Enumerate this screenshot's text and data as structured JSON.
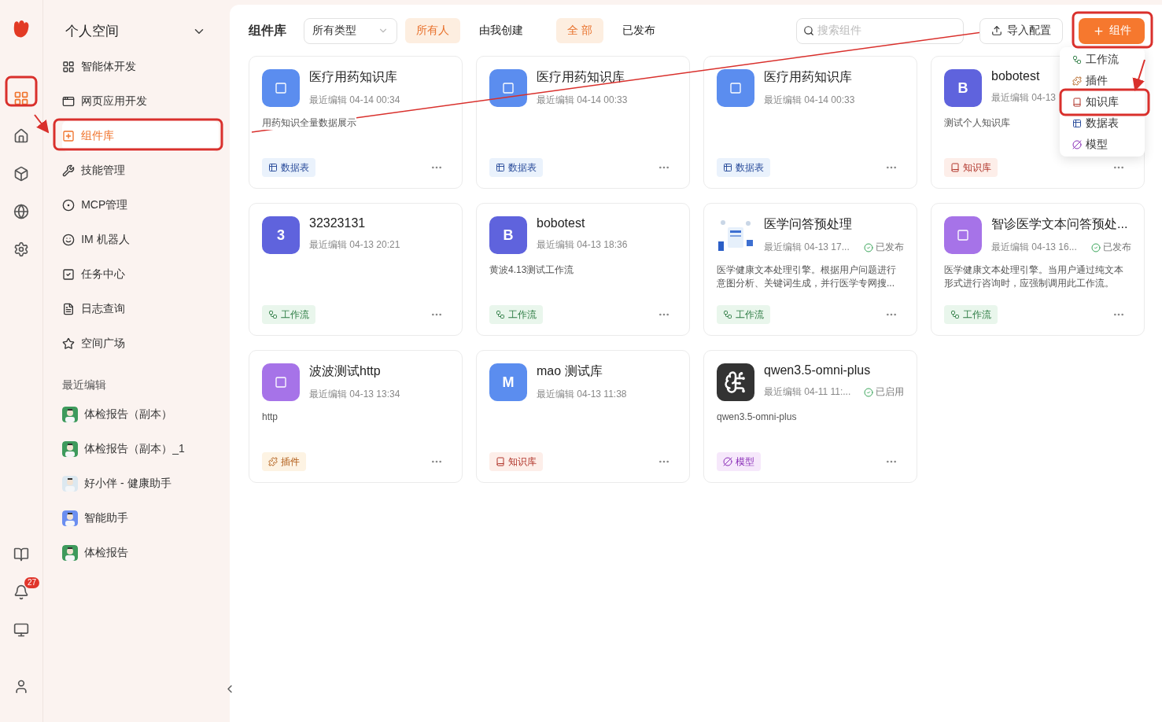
{
  "rail": {
    "items": [
      {
        "selected": true
      },
      {
        "selected": false
      },
      {
        "selected": false
      },
      {
        "selected": false
      },
      {
        "selected": false
      }
    ],
    "badge": "27"
  },
  "sidebar": {
    "title": "个人空间",
    "items": [
      {
        "label": "智能体开发",
        "selected": false
      },
      {
        "label": "网页应用开发",
        "selected": false
      },
      {
        "label": "组件库",
        "selected": true
      },
      {
        "label": "技能管理",
        "selected": false
      },
      {
        "label": "MCP管理",
        "selected": false
      },
      {
        "label": "IM 机器人",
        "selected": false
      },
      {
        "label": "任务中心",
        "selected": false
      },
      {
        "label": "日志查询",
        "selected": false
      },
      {
        "label": "空间广场",
        "selected": false
      }
    ],
    "recent_title": "最近编辑",
    "recent": [
      {
        "label": "体检报告（副本）"
      },
      {
        "label": "体检报告（副本）_1"
      },
      {
        "label": "好小伴 - 健康助手"
      },
      {
        "label": "智能助手"
      },
      {
        "label": "体检报告"
      }
    ]
  },
  "toolbar": {
    "title": "组件库",
    "type_select": "所有类型",
    "owner_filters": [
      {
        "label": "所有人",
        "selected": true
      },
      {
        "label": "由我创建",
        "selected": false
      }
    ],
    "status_filters": [
      {
        "label": "全 部",
        "selected": true
      },
      {
        "label": "已发布",
        "selected": false
      }
    ],
    "search": {
      "placeholder": "搜索组件"
    },
    "import_button": "导入配置",
    "add_button": "组件"
  },
  "add_menu": [
    {
      "label": "工作流",
      "kind": "workflow"
    },
    {
      "label": "插件",
      "kind": "plugin"
    },
    {
      "label": "知识库",
      "kind": "knowledge"
    },
    {
      "label": "数据表",
      "kind": "table"
    },
    {
      "label": "模型",
      "kind": "model"
    }
  ],
  "cards": [
    {
      "title": "医疗用药知识库",
      "meta": "最近编辑 04-14 00:34",
      "description": "用药知识全量数据展示",
      "tag": {
        "label": "数据表",
        "kind": "table"
      },
      "avatar": {
        "kind": "glyph",
        "color": "#5b8def"
      }
    },
    {
      "title": "医疗用药知识库",
      "meta": "最近编辑 04-14 00:33",
      "tag": {
        "label": "数据表",
        "kind": "table"
      },
      "avatar": {
        "kind": "glyph",
        "color": "#5b8def"
      }
    },
    {
      "title": "医疗用药知识库",
      "meta": "最近编辑 04-14 00:33",
      "tag": {
        "label": "数据表",
        "kind": "table"
      },
      "avatar": {
        "kind": "glyph",
        "color": "#5b8def"
      }
    },
    {
      "title": "bobotest",
      "meta": "最近编辑 04-13",
      "description": "测试个人知识库",
      "tag": {
        "label": "知识库",
        "kind": "knowledge"
      },
      "avatar": {
        "kind": "letter",
        "text": "B",
        "color": "#5f63dd"
      }
    },
    {
      "title": "32323131",
      "meta": "最近编辑 04-13 20:21",
      "tag": {
        "label": "工作流",
        "kind": "workflow"
      },
      "avatar": {
        "kind": "letter",
        "text": "3",
        "color": "#5f63dd"
      }
    },
    {
      "title": "bobotest",
      "meta": "最近编辑 04-13 18:36",
      "description": "黄波4.13测试工作流",
      "tag": {
        "label": "工作流",
        "kind": "workflow"
      },
      "avatar": {
        "kind": "letter",
        "text": "B",
        "color": "#5f63dd"
      }
    },
    {
      "title": "医学问答预处理",
      "meta": "最近编辑 04-13 17...",
      "status": "已发布",
      "description": "医学健康文本处理引擎。根据用户问题进行意图分析、关键词生成，并行医学专网搜...",
      "tag": {
        "label": "工作流",
        "kind": "workflow"
      }
    },
    {
      "title": "智诊医学文本问答预处...",
      "meta": "最近编辑 04-13 16...",
      "status": "已发布",
      "description": "医学健康文本处理引擎。当用户通过纯文本形式进行咨询时，应强制调用此工作流。",
      "tag": {
        "label": "工作流",
        "kind": "workflow"
      },
      "avatar": {
        "kind": "glyph",
        "color": "#a673e8"
      }
    },
    {
      "title": "波波测试http",
      "meta": "最近编辑 04-13 13:34",
      "description": "http",
      "tag": {
        "label": "插件",
        "kind": "plugin"
      },
      "avatar": {
        "kind": "glyph",
        "color": "#a673e8"
      }
    },
    {
      "title": "mao 测试库",
      "meta": "最近编辑 04-13 11:38",
      "tag": {
        "label": "知识库",
        "kind": "knowledge"
      },
      "avatar": {
        "kind": "letter",
        "text": "M",
        "color": "#5b8def"
      }
    },
    {
      "title": "qwen3.5-omni-plus",
      "meta": "最近编辑 04-11 11:...",
      "status": "已启用",
      "description": "qwen3.5-omni-plus",
      "tag": {
        "label": "模型",
        "kind": "model"
      },
      "avatar": {
        "kind": "brain"
      }
    }
  ]
}
